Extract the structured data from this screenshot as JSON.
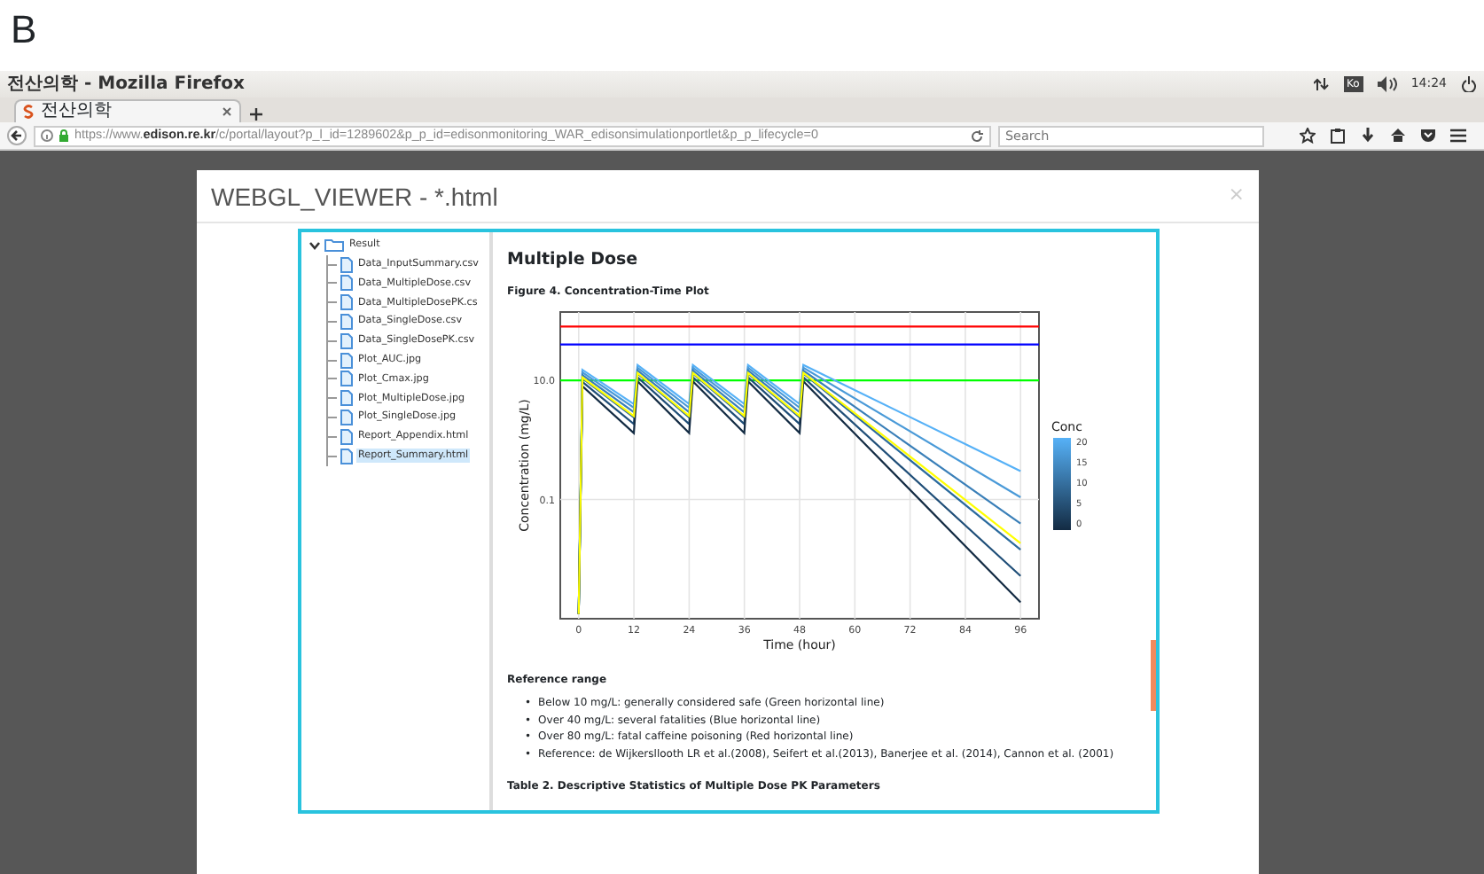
{
  "figure_label": "B",
  "system_bar": {
    "title": "전산의학 - Mozilla Firefox",
    "keyboard": "Ko",
    "time": "14:24"
  },
  "tabs": [
    {
      "label": "전산의학",
      "selected": true
    }
  ],
  "address_bar": {
    "url_prefix": "https://www.",
    "url_domain": "edison.re.kr",
    "url_path": "/c/portal/layout?p_l_id=1289602&p_p_id=edisonmonitoring_WAR_edisonsimulationportlet&p_p_lifecycle=0"
  },
  "search": {
    "placeholder": "Search"
  },
  "modal": {
    "title": "WEBGL_VIEWER - *.html",
    "close": "×"
  },
  "tree": [
    {
      "label": "Result",
      "expanded": true,
      "children": [
        {
          "label": "Data_InputSummary.csv",
          "selected": false
        },
        {
          "label": "Data_MultipleDose.csv",
          "selected": false
        },
        {
          "label": "Data_MultipleDosePK.cs",
          "selected": false
        },
        {
          "label": "Data_SingleDose.csv",
          "selected": false
        },
        {
          "label": "Data_SingleDosePK.csv",
          "selected": false
        },
        {
          "label": "Plot_AUC.jpg",
          "selected": false
        },
        {
          "label": "Plot_Cmax.jpg",
          "selected": false
        },
        {
          "label": "Plot_MultipleDose.jpg",
          "selected": false
        },
        {
          "label": "Plot_SingleDose.jpg",
          "selected": false
        },
        {
          "label": "Report_Appendix.html",
          "selected": false
        },
        {
          "label": "Report_Summary.html",
          "selected": true
        }
      ]
    }
  ],
  "report": {
    "heading": "Multiple Dose",
    "figure_caption": "Figure 4. Concentration-Time Plot",
    "plot": {
      "xlabel": "Time (hour)",
      "ylabel": "Concentration (mg/L)",
      "xtick_labels": [
        "0",
        "12",
        "24",
        "36",
        "48",
        "60",
        "72",
        "84",
        "96"
      ],
      "ytick_labels": [
        "10.0",
        "0.1"
      ],
      "legend_title": "Conc",
      "legend_ticks": [
        "20",
        "15",
        "10",
        "5",
        "0"
      ]
    },
    "reference_heading": "Reference range",
    "references": [
      {
        "marker": "•",
        "text": "Below 10 mg/L: generally considered safe (Green horizontal line)"
      },
      {
        "marker": "•",
        "text": "Over 40 mg/L: several fatalities (Blue horizontal line)"
      },
      {
        "marker": "•",
        "text": "Over 80 mg/L: fatal caffeine poisoning (Red horizontal line)"
      },
      {
        "marker": "•",
        "text": "Reference: de Wijkersllooth LR et al.(2008), Seifert et al.(2013), Banerjee et al. (2014), Cannon et al. (2001)"
      }
    ],
    "table_caption": "Table 2. Descriptive Statistics of Multiple Dose PK Parameters"
  }
}
